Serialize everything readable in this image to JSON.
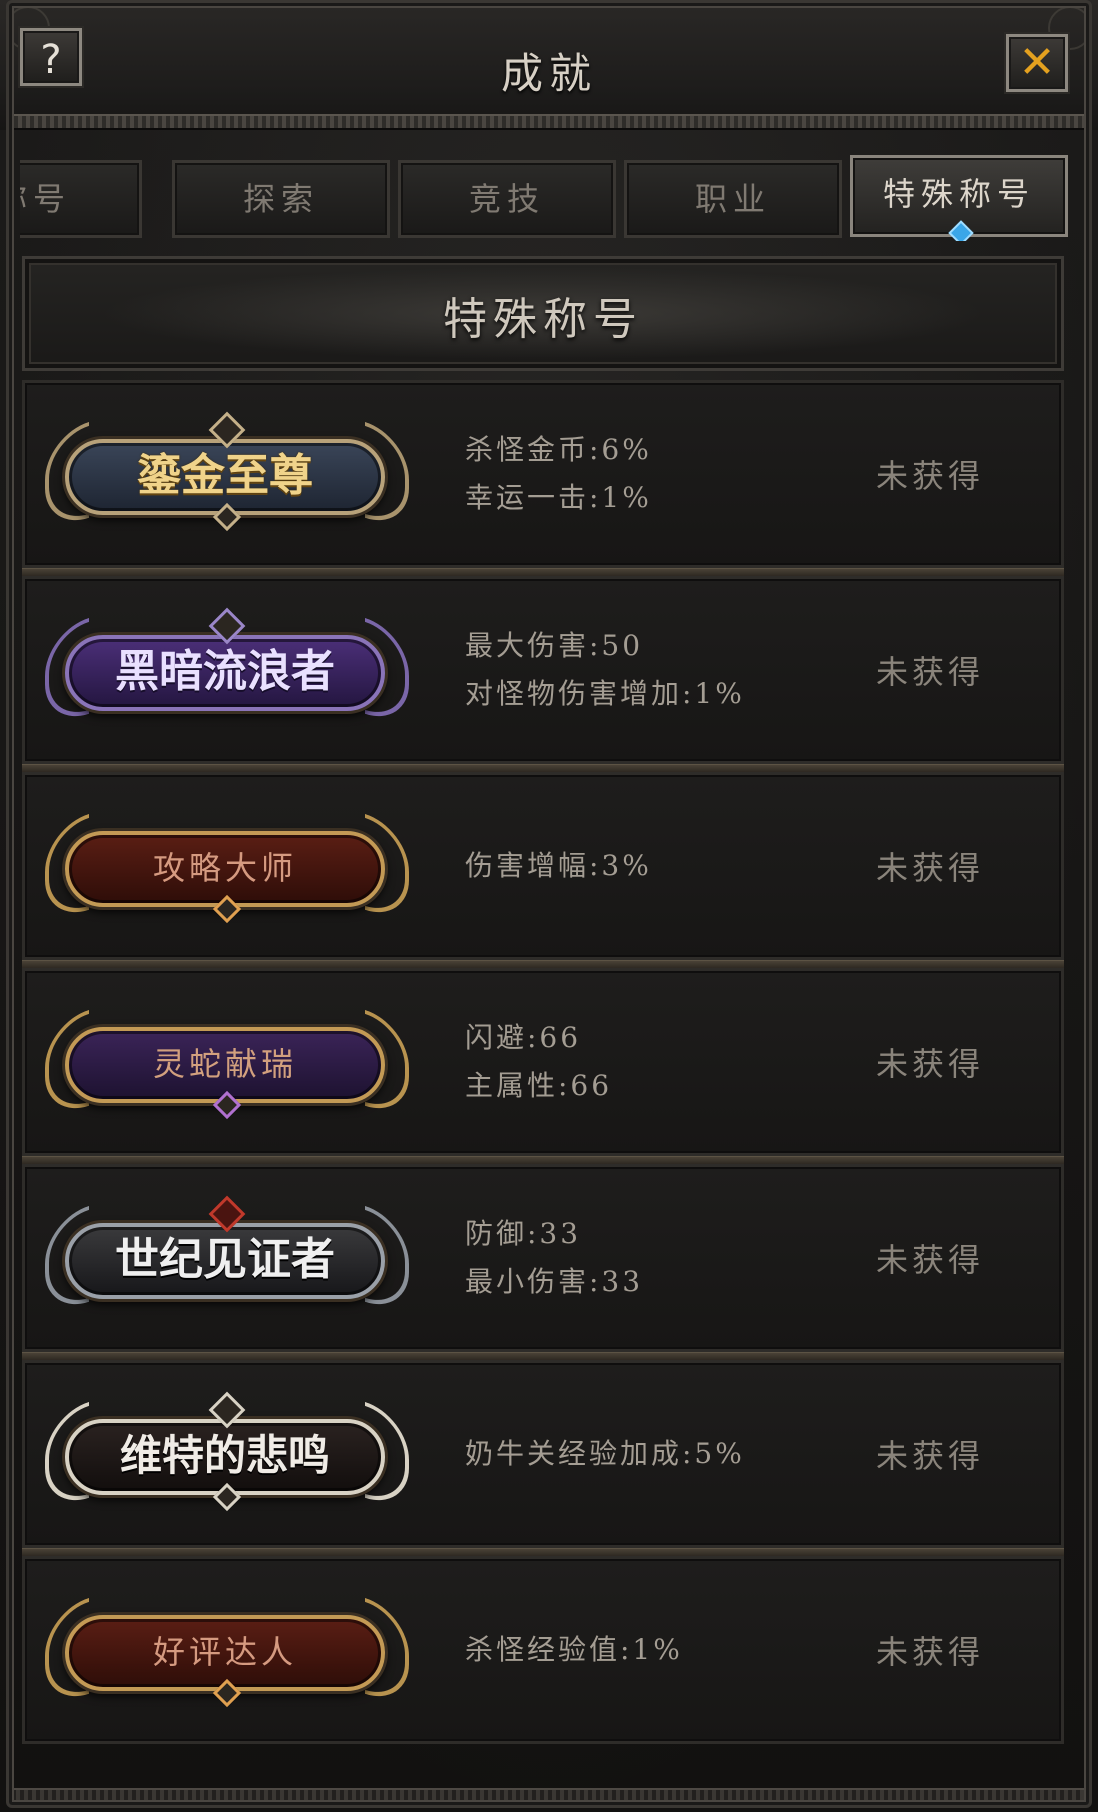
{
  "header": {
    "title": "成就",
    "help_label": "?",
    "close_label": "✕"
  },
  "tabs": [
    {
      "label": "称号",
      "active": false
    },
    {
      "label": "探索",
      "active": false
    },
    {
      "label": "竞技",
      "active": false
    },
    {
      "label": "职业",
      "active": false
    },
    {
      "label": "特殊称号",
      "active": true
    }
  ],
  "section": {
    "title": "特殊称号"
  },
  "titles": [
    {
      "badge": "鎏金至尊",
      "style": "gold",
      "attributes": [
        "杀怪金币:6%",
        "幸运一击:1%"
      ],
      "status": "未获得"
    },
    {
      "badge": "黑暗流浪者",
      "style": "purple",
      "attributes": [
        "最大伤害:50",
        "对怪物伤害增加:1%"
      ],
      "status": "未获得"
    },
    {
      "badge": "攻略大师",
      "style": "red",
      "attributes": [
        "伤害增幅:3%"
      ],
      "status": "未获得"
    },
    {
      "badge": "灵蛇献瑞",
      "style": "violet",
      "attributes": [
        "闪避:66",
        "主属性:66"
      ],
      "status": "未获得"
    },
    {
      "badge": "世纪见证者",
      "style": "steel",
      "attributes": [
        "防御:33",
        "最小伤害:33"
      ],
      "status": "未获得"
    },
    {
      "badge": "维特的悲鸣",
      "style": "bone",
      "attributes": [
        "奶牛关经验加成:5%"
      ],
      "status": "未获得"
    },
    {
      "badge": "好评达人",
      "style": "red2",
      "attributes": [
        "杀怪经验值:1%"
      ],
      "status": "未获得"
    }
  ],
  "colors": {
    "background": "#141312",
    "title_text": "#d7d0c5",
    "attr_text": "#a49d93",
    "status_text": "#8a847b",
    "close_accent": "#e4a11f",
    "active_tab_gem": "#3aa6e8"
  }
}
